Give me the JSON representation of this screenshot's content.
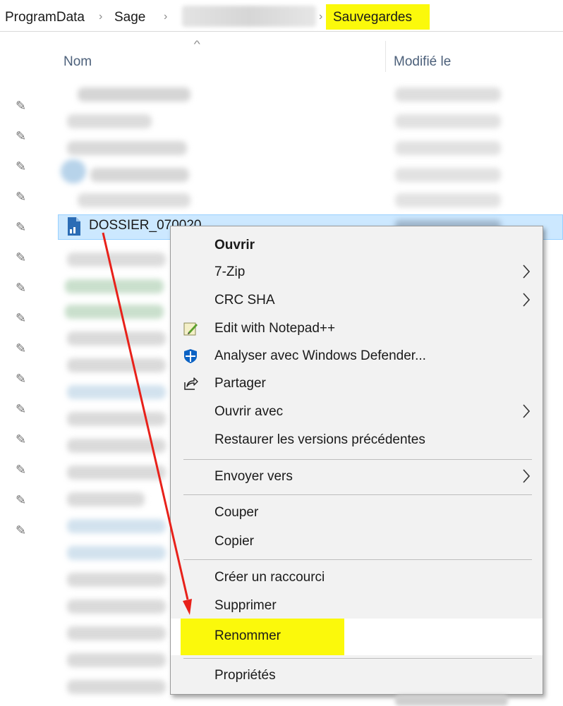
{
  "breadcrumb": {
    "items": [
      "ProgramData",
      "Sage"
    ],
    "current": "Sauvegardes",
    "separator": "›"
  },
  "columns": {
    "name": "Nom",
    "modified": "Modifié le"
  },
  "selected_file": {
    "name": "DOSSIER_070020"
  },
  "context_menu": {
    "items": [
      {
        "label": "Ouvrir"
      },
      {
        "label": "7-Zip"
      },
      {
        "label": "CRC SHA"
      },
      {
        "label": "Edit with Notepad++"
      },
      {
        "label": "Analyser avec Windows Defender..."
      },
      {
        "label": "Partager"
      },
      {
        "label": "Ouvrir avec"
      },
      {
        "label": "Restaurer les versions précédentes"
      },
      {
        "label": "Envoyer vers"
      },
      {
        "label": "Couper"
      },
      {
        "label": "Copier"
      },
      {
        "label": "Créer un raccourci"
      },
      {
        "label": "Supprimer"
      },
      {
        "label": "Renommer"
      },
      {
        "label": "Propriétés"
      }
    ]
  },
  "colors": {
    "highlight": "#fbf90b",
    "selection": "#cce8ff",
    "arrow": "#e8211a"
  }
}
